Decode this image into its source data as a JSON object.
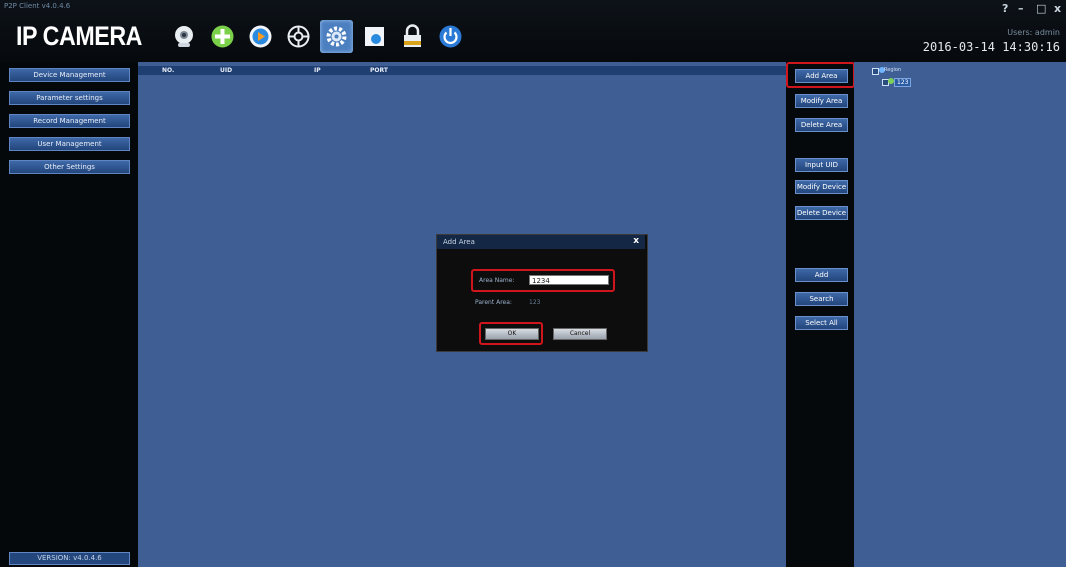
{
  "window": {
    "title": "P2P Client v4.0.4.6",
    "controls": [
      "?",
      "–",
      "□",
      "x"
    ]
  },
  "header": {
    "logo": "IP CAMERA",
    "user": "Users: admin",
    "datetime": "2016-03-14 14:30:16",
    "toolbar": [
      {
        "icon": "camera-icon",
        "active": false
      },
      {
        "icon": "add-device-icon",
        "active": false
      },
      {
        "icon": "playback-icon",
        "active": false
      },
      {
        "icon": "ptz-control-icon",
        "active": false
      },
      {
        "icon": "settings-gear-icon",
        "active": true
      },
      {
        "icon": "log-icon",
        "active": false
      },
      {
        "icon": "lock-icon",
        "active": false
      },
      {
        "icon": "power-icon",
        "active": false
      }
    ]
  },
  "sidebar": {
    "items": [
      {
        "label": "Device Management"
      },
      {
        "label": "Parameter settings"
      },
      {
        "label": "Record Management"
      },
      {
        "label": "User Management"
      },
      {
        "label": "Other Settings"
      }
    ],
    "version": "VERSION: v4.0.4.6"
  },
  "table": {
    "columns": [
      "NO.",
      "UID",
      "IP",
      "PORT"
    ]
  },
  "dialog": {
    "title": "Add Area",
    "close": "x",
    "area_name_label": "Area Name:",
    "area_name_value": "1234",
    "parent_area_label": "Parent Area:",
    "parent_area_value": "123",
    "ok": "OK",
    "cancel": "Cancel"
  },
  "actions": {
    "add_area": "Add Area",
    "modify_area": "Modify Area",
    "delete_area": "Delete Area",
    "input_uid": "Input UID",
    "modify_device": "Modify Device",
    "delete_device": "Delete Device",
    "add": "Add",
    "search": "Search",
    "select_all": "Select All"
  },
  "tree": {
    "root": "Region",
    "child": "123"
  },
  "colors": {
    "highlight": "#d0161c",
    "panel_blue": "#3f5e93",
    "button_blue": "#2f589a"
  }
}
